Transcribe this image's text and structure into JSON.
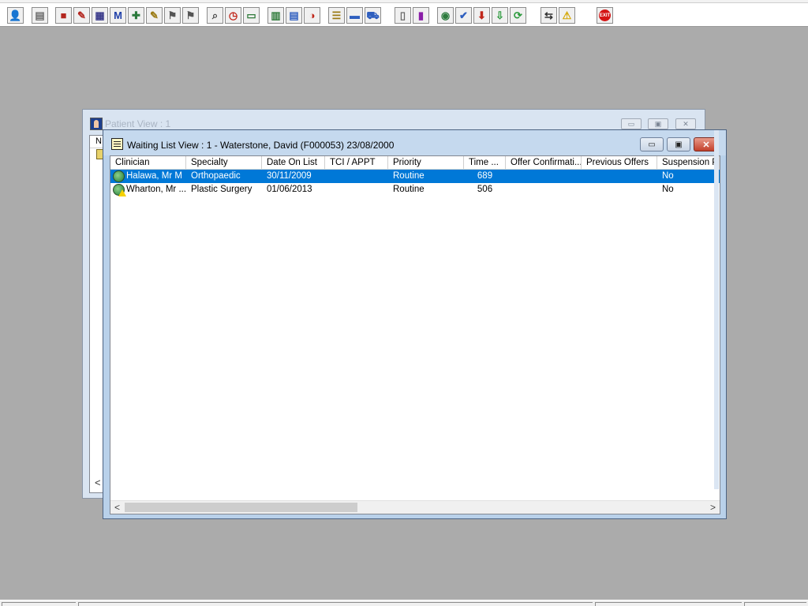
{
  "toolbar": {
    "buttons": [
      {
        "name": "patient-icon",
        "glyph": "👤",
        "color": "#2f5fbf"
      },
      {
        "name": "printer-icon",
        "glyph": "▤",
        "color": "#6a6a6a"
      },
      {
        "name": "book-icon",
        "glyph": "■",
        "color": "#b3261e"
      },
      {
        "name": "folder-edit-icon",
        "glyph": "✎",
        "color": "#b3261e"
      },
      {
        "name": "scan-icon",
        "glyph": "▦",
        "color": "#3a3a8a"
      },
      {
        "name": "letter-m-icon",
        "glyph": "M",
        "color": "#1f3fa8"
      },
      {
        "name": "doctor-icon",
        "glyph": "✚",
        "color": "#2c7a3d"
      },
      {
        "name": "notes-icon",
        "glyph": "✎",
        "color": "#9a7a14"
      },
      {
        "name": "flag-icon",
        "glyph": "⚑",
        "color": "#555"
      },
      {
        "name": "flag-alt-icon",
        "glyph": "⚑",
        "color": "#555"
      },
      {
        "name": "search-doc-icon",
        "glyph": "⌕",
        "color": "#444"
      },
      {
        "name": "clock-icon",
        "glyph": "◷",
        "color": "#c0271b"
      },
      {
        "name": "monitor-icon",
        "glyph": "▭",
        "color": "#2f7a3a"
      },
      {
        "name": "chart-icon",
        "glyph": "▥",
        "color": "#2f7a3a"
      },
      {
        "name": "form-icon",
        "glyph": "▤",
        "color": "#2f5fbf"
      },
      {
        "name": "dial-icon",
        "glyph": "◑",
        "color": "#c0271b"
      },
      {
        "name": "list-icon",
        "glyph": "☰",
        "color": "#9a7a14"
      },
      {
        "name": "bed-icon",
        "glyph": "▬",
        "color": "#2f5fbf"
      },
      {
        "name": "ambulance-icon",
        "glyph": "⛟",
        "color": "#2f5fbf"
      },
      {
        "name": "document-icon",
        "glyph": "▯",
        "color": "#6a6a6a"
      },
      {
        "name": "bar-chart-icon",
        "glyph": "▮",
        "color": "#8a1fa8"
      },
      {
        "name": "globe-icon",
        "glyph": "◉",
        "color": "#2c7a3d"
      },
      {
        "name": "checklist-icon",
        "glyph": "✔",
        "color": "#2f5fbf"
      },
      {
        "name": "download-icon",
        "glyph": "⬇",
        "color": "#c0271b"
      },
      {
        "name": "transfer-icon",
        "glyph": "⇩",
        "color": "#2c9a3d"
      },
      {
        "name": "refresh-icon",
        "glyph": "⟳",
        "color": "#2c9a3d"
      },
      {
        "name": "swap-icon",
        "glyph": "⇆",
        "color": "#333"
      },
      {
        "name": "warning-icon",
        "glyph": "⚠",
        "color": "#d4a600"
      },
      {
        "name": "exit-icon",
        "glyph": "EXIT",
        "color": "#d41414"
      }
    ]
  },
  "patient_view": {
    "title": "Patient View : 1",
    "min": "▭",
    "max": "▣",
    "close": "✕",
    "col_header": "N",
    "scroll_left": "<"
  },
  "waiting_list": {
    "title": "Waiting List View :  1 - Waterstone, David (F000053) 23/08/2000",
    "min": "▭",
    "max": "▣",
    "close": "✕",
    "columns": [
      "Clinician",
      "Specialty",
      "Date On List",
      "TCI / APPT",
      "Priority",
      "Time ...",
      "Offer Confirmati...",
      "Previous Offers",
      "Suspension Pe"
    ],
    "rows": [
      {
        "clinician": "Halawa, Mr M",
        "specialty": "Orthopaedic",
        "date_on_list": "30/11/2009",
        "tci_appt": "",
        "priority": "Routine",
        "time": "689",
        "offer_confirmation": "",
        "previous_offers": "",
        "suspension": "No",
        "selected": true,
        "warning": false
      },
      {
        "clinician": "Wharton, Mr ...",
        "specialty": "Plastic Surgery",
        "date_on_list": "01/06/2013",
        "tci_appt": "",
        "priority": "Routine",
        "time": "506",
        "offer_confirmation": "",
        "previous_offers": "",
        "suspension": "No",
        "selected": false,
        "warning": true
      }
    ],
    "scroll_left": "<",
    "scroll_right": ">"
  }
}
